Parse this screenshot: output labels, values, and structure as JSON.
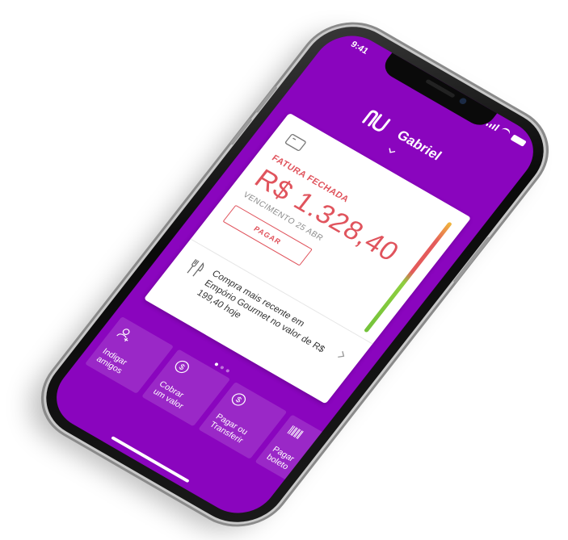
{
  "status": {
    "time": "9:41"
  },
  "header": {
    "user_name": "Gabriel",
    "brand_icon": "nubank-logo"
  },
  "card": {
    "label": "FATURA FECHADA",
    "amount": "R$ 1.328,40",
    "due": "VENCIMENTO 25 ABR",
    "pay_label": "PAGAR",
    "recent": "Compra mais recente em Empório Gourmet no valor de R$ 199,40 hoje"
  },
  "pager": {
    "count": 3,
    "active": 0
  },
  "shortcuts": [
    {
      "label": "Indigar\namigos",
      "icon": "add-friend-icon"
    },
    {
      "label": "Cobrar\num valor",
      "icon": "charge-icon"
    },
    {
      "label": "Pagar ou\nTransferir",
      "icon": "transfer-icon"
    },
    {
      "label": "Pagar\nboleto",
      "icon": "barcode-icon"
    }
  ],
  "colors": {
    "purple": "#8a05be",
    "red": "#e0545d"
  }
}
